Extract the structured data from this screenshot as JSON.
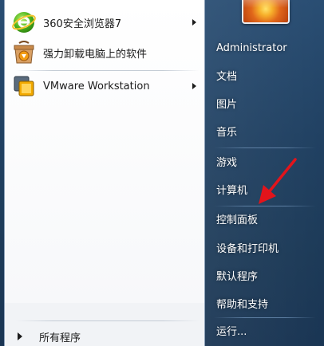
{
  "start_menu": {
    "programs": [
      {
        "label": "360安全浏览器7",
        "icon": "360-browser-icon",
        "has_submenu": true
      },
      {
        "label": "强力卸载电脑上的软件",
        "icon": "uninstaller-icon",
        "has_submenu": false
      },
      {
        "label": "VMware Workstation",
        "icon": "vmware-icon",
        "has_submenu": true
      }
    ],
    "all_programs_label": "所有程序",
    "right_items": [
      {
        "label": "Administrator"
      },
      {
        "label": "文档"
      },
      {
        "label": "图片"
      },
      {
        "label": "音乐"
      },
      {
        "label": "游戏"
      },
      {
        "label": "计算机"
      },
      {
        "label": "控制面板"
      },
      {
        "label": "设备和打印机"
      },
      {
        "label": "默认程序"
      },
      {
        "label": "帮助和支持"
      },
      {
        "label": "运行..."
      }
    ]
  },
  "colors": {
    "left_panel_bg": "#ffffff",
    "right_pane_bg": "#1d3f62",
    "annotation_arrow": "#e3141b"
  }
}
